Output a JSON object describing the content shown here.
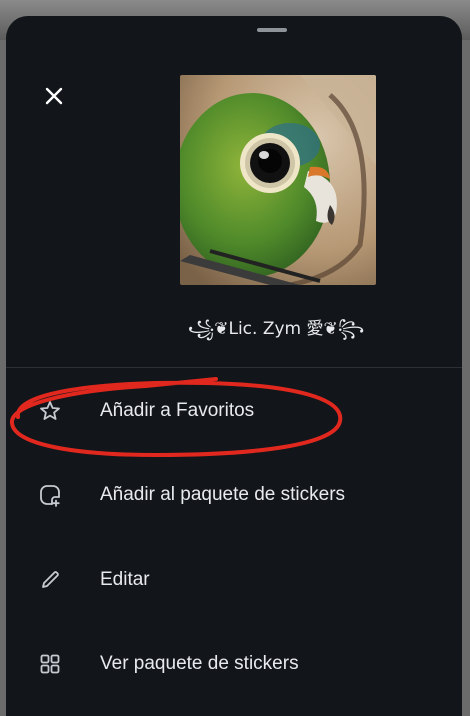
{
  "sheet": {
    "close_icon": "close-icon",
    "author_name": "꧁❦Lic. Zym 愛❦꧂"
  },
  "menu": {
    "items": [
      {
        "label": "Añadir a Favoritos",
        "icon": "star-icon"
      },
      {
        "label": "Añadir al paquete de stickers",
        "icon": "add-sticker-icon"
      },
      {
        "label": "Editar",
        "icon": "pencil-icon"
      },
      {
        "label": "Ver paquete de stickers",
        "icon": "grid-icon"
      }
    ]
  },
  "colors": {
    "sheet_background": "#121519",
    "text": "#e8eaed",
    "annotation": "#e0281e"
  }
}
